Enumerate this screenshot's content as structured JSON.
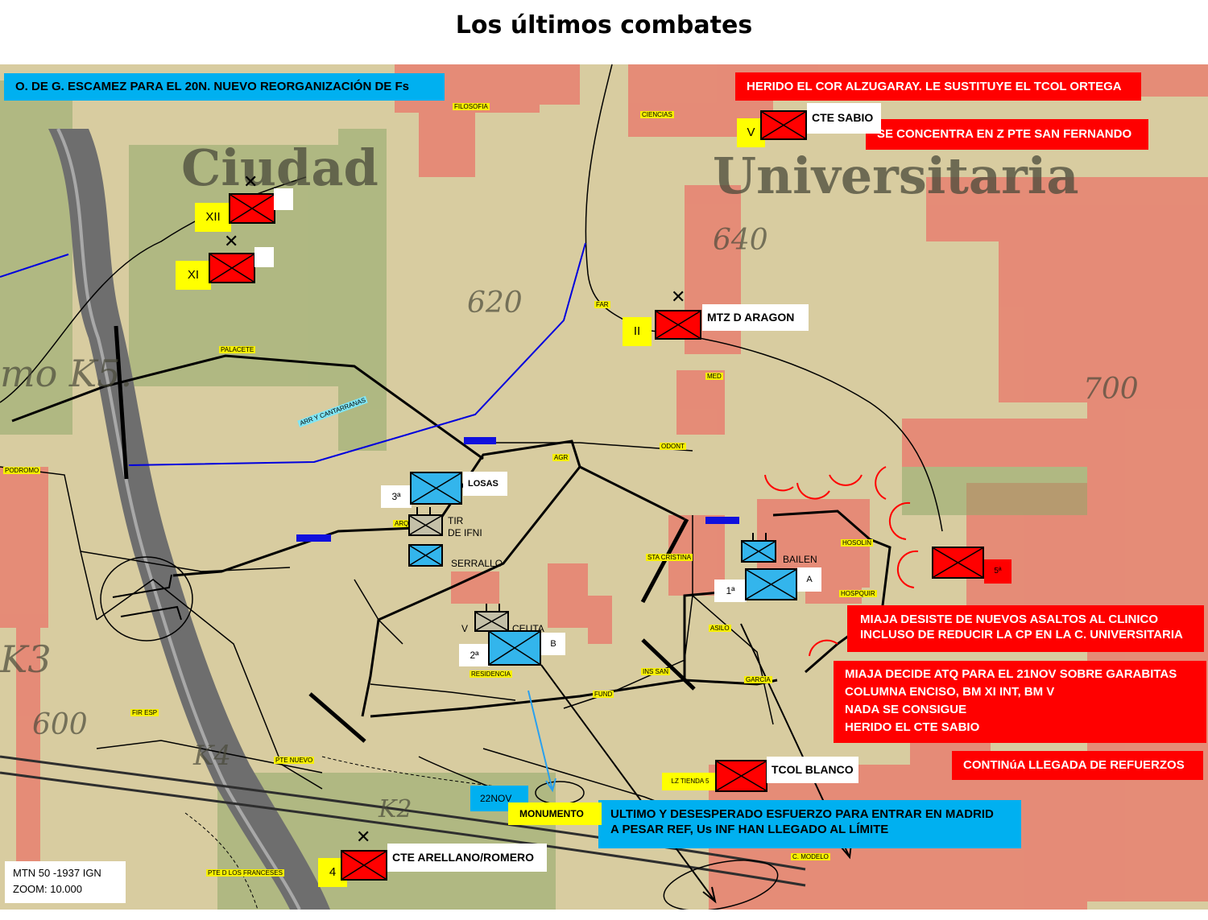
{
  "title": "Los últimos combates",
  "colors": {
    "red_unit": "#ff0000",
    "blue_unit": "#33b5ec",
    "info_blue": "#00b0f0",
    "label_yellow": "#ffff00",
    "map_base": "#d8cca0",
    "urban": "#e88070"
  },
  "banners": {
    "orders": "O. DE G. ESCAMEZ  PARA EL 20N. NUEVO  REORGANIZACIÓN DE Fs",
    "herido_cor": "HERIDO EL COR ALZUGARAY. LE SUSTITUYE EL TCOL ORTEGA",
    "se_concentra": "SE CONCENTRA EN Z PTE SAN FERNANDO",
    "miaja_desiste_1": "MIAJA DESISTE DE NUEVOS ASALTOS AL CLINICO",
    "miaja_desiste_2": "INCLUSO DE REDUCIR LA CP EN LA C. UNIVERSITARIA",
    "miaja_decide_1": "MIAJA DECIDE ATQ  PARA EL 21NOV SOBRE GARABITAS",
    "miaja_decide_2": "COLUMNA ENCISO, BM  XI INT,  BM V",
    "miaja_decide_3": "NADA SE CONSIGUE",
    "miaja_decide_4": "HERIDO EL CTE SABIO",
    "refuerzos": "CONTINúA LLEGADA DE REFUERZOS",
    "ultimo_1": "ULTIMO Y DESESPERADO ESFUERZO PARA ENTRAR EN MADRID",
    "ultimo_2": "A PESAR REF, Us INF HAN LLEGADO AL LÍMITE",
    "date": "22NOV",
    "monumento": "MONUMENTO"
  },
  "units": {
    "cte_sabio": "CTE SABIO",
    "cte_sabio_num": "V",
    "xii": "XII",
    "xi": "XI",
    "mtz_aragon": "MTZ D ARAGON",
    "mtz_aragon_num": "II",
    "losas": "LOSAS",
    "losas_num": "3ª",
    "tir_ifni_1": "TIR",
    "tir_ifni_2": "DE IFNI",
    "serrallo": "SERRALLO",
    "bailen": "BAILEN",
    "bailen_a": "A",
    "bailen_num": "1ª",
    "ceuta": "CEUTA",
    "ceuta_v": "V",
    "ceuta_b": "B",
    "ceuta_num": "2ª",
    "quinta": "5ª",
    "tcol_blanco": "TCOL BLANCO",
    "lz_tienda": "LZ TIENDA 5",
    "cte_arellano": "CTE ARELLANO/ROMERO",
    "cte_arellano_num": "4"
  },
  "map_labels": {
    "filosofia": "FILOSOFIA",
    "ciencias": "CIENCIAS",
    "far": "FAR",
    "med": "MED",
    "odont": "ODONT",
    "agr": "AGR",
    "palacete": "PALACETE",
    "arr_cantarranas": "ARR Y CANTARRANAS",
    "podromo": "PODROMO",
    "arq": "ARQ",
    "sta_cristina": "STA CRISTINA",
    "hosolin": "HOSOLIN",
    "hospquir": "HOSPQUIR",
    "asilo": "ASILO",
    "ins_san": "INS SAN",
    "fund": "FUND",
    "residencia": "RESIDENCIA",
    "fir_esp": "FIR ESP",
    "pte_nuevo": "PTE NUEVO",
    "pte_franceses": "PTE D LOS FRANCESES",
    "c_modelo": "C. MODELO",
    "garcia": "GARCIA",
    "elev_640": "640",
    "elev_620": "620",
    "elev_700": "700",
    "elev_600": "600",
    "ciudad": "Ciudad",
    "universitaria": "Universitaria",
    "mo_k5": "mo K5.",
    "k3": "K3",
    "k2": "K2",
    "k4": "K4"
  },
  "footer": {
    "line1": "MTN 50 -1937 IGN",
    "line2": "ZOOM: 10.000"
  }
}
